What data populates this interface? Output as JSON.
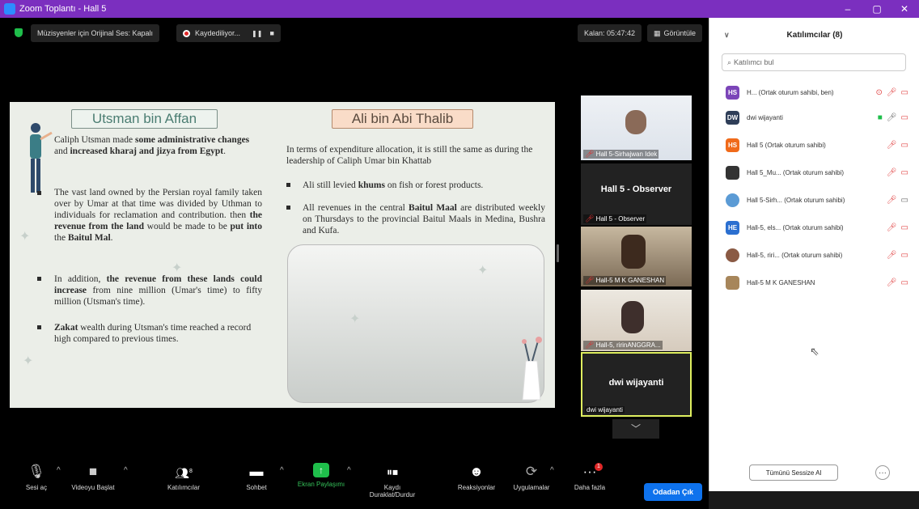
{
  "window": {
    "title": "Zoom Toplantı - Hall 5",
    "minimize": "–",
    "maximize": "▢",
    "close": "✕"
  },
  "topbar": {
    "original_sound": "Müzisyenler için Orijinal Ses: Kapalı",
    "recording": "Kaydediliyor...",
    "pause": "❚❚",
    "stop": "■",
    "remaining": "Kalan: 05:47:42",
    "view": "Görüntüle"
  },
  "slide": {
    "left_header": "Utsman bin Affan",
    "right_header": "Ali bin Abi Thalib",
    "left_intro": [
      "Caliph Utsman made ",
      "some administrative changes",
      " and ",
      "increased kharaj and jizya from Egypt",
      "."
    ],
    "left_bullets": [
      [
        "The vast land owned by the Persian royal family taken over by Umar at that time was divided by Uthman to individuals for reclamation and contribution. then ",
        "the revenue from the land",
        " would be made to be ",
        "put into",
        " the ",
        "Baitul Mal",
        "."
      ],
      [
        "In addition, ",
        "the revenue from these lands could increase",
        " from nine million (Umar's time) to fifty million (Utsman's time)."
      ],
      [
        "",
        "Zakat",
        " wealth during Utsman's time reached a record high compared to previous times."
      ]
    ],
    "right_intro": "In terms of expenditure allocation, it is still the same as during the leadership of Caliph Umar bin Khattab",
    "right_bullets": [
      [
        "Ali still levied ",
        "khums",
        " on fish or forest products."
      ],
      [
        "All revenues in the central ",
        "Baitul Maal",
        " are distributed weekly on Thursdays to the provincial Baitul Maals in Medina, Bushra and Kufa."
      ]
    ]
  },
  "tiles": [
    {
      "label": "Hall 5-Sirhajwan Idek"
    },
    {
      "center": "Hall 5 - Observer",
      "label": "Hall 5 - Observer"
    },
    {
      "label": "Hall-5 M K GANESHAN"
    },
    {
      "label": "Hall-5, ririnANGGRA..."
    },
    {
      "center": "dwi wijayanti",
      "label": "dwi wijayanti"
    }
  ],
  "controls": [
    {
      "label": "Sesi aç",
      "icon": "mic-muted-icon"
    },
    {
      "label": "Videoyu Başlat",
      "icon": "video-off-icon"
    },
    {
      "label": "Katılımcılar",
      "icon": "participants-icon",
      "count": "8"
    },
    {
      "label": "Sohbet",
      "icon": "chat-icon"
    },
    {
      "label": "Ekran Paylaşımı",
      "icon": "share-screen-icon"
    },
    {
      "label": "Kaydı Duraklat/Durdur",
      "icon": "record-icon"
    },
    {
      "label": "Reaksiyonlar",
      "icon": "reactions-icon"
    },
    {
      "label": "Uygulamalar",
      "icon": "apps-icon"
    },
    {
      "label": "Daha fazla",
      "icon": "more-icon",
      "badge": "1"
    }
  ],
  "leave": "Odadan Çık",
  "panel": {
    "title": "Katılımcılar (8)",
    "search_placeholder": "Katılımcı bul",
    "participants": [
      {
        "initials": "HS",
        "color": "#7b45b8",
        "name": "H... (Ortak oturum sahibi, ben)"
      },
      {
        "initials": "DW",
        "color": "#2f3e58",
        "name": "dwi wijayanti"
      },
      {
        "initials": "HS",
        "color": "#f06a1a",
        "name": "Hall 5 (Ortak oturum sahibi)"
      },
      {
        "initials": "",
        "color": "#333333",
        "name": "Hall 5_Mu... (Ortak oturum sahibi)"
      },
      {
        "initials": "",
        "color": "#5b9bd5",
        "name": "Hall 5-Sirh... (Ortak oturum sahibi)"
      },
      {
        "initials": "HE",
        "color": "#2b6fd0",
        "name": "Hall-5, els... (Ortak oturum sahibi)"
      },
      {
        "initials": "",
        "color": "#8a5a44",
        "name": "Hall-5, riri... (Ortak oturum sahibi)"
      },
      {
        "initials": "",
        "color": "#a7865b",
        "name": "Hall-5 M K GANESHAN"
      }
    ],
    "mute_all": "Tümünü Sessize Al",
    "more": "···"
  }
}
